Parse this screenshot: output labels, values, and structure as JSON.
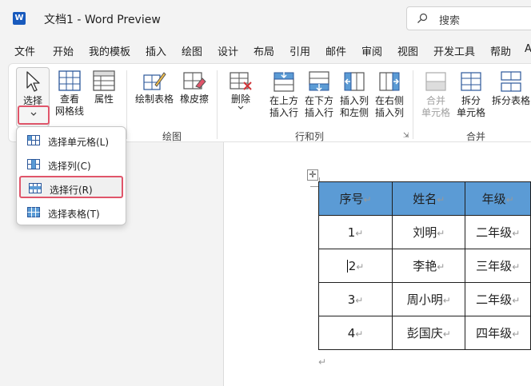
{
  "window": {
    "app_icon_letter": "W",
    "title": "文档1  -  Word Preview",
    "search_placeholder": "搜索"
  },
  "menu": {
    "tabs": [
      "文件",
      "开始",
      "我的模板",
      "插入",
      "绘图",
      "设计",
      "布局",
      "引用",
      "邮件",
      "审阅",
      "视图",
      "开发工具",
      "帮助",
      "A"
    ]
  },
  "ribbon": {
    "select_label": "选择",
    "view_gridlines_line1": "查看",
    "view_gridlines_line2": "网格线",
    "properties_label": "属性",
    "draw_table_label": "绘制表格",
    "eraser_label": "橡皮擦",
    "delete_label": "删除",
    "insert_above_line1": "在上方",
    "insert_above_line2": "插入行",
    "insert_below_line1": "在下方",
    "insert_below_line2": "插入行",
    "insert_left_line1": "插入列",
    "insert_left_line2": "和左侧",
    "insert_right_line1": "在右侧",
    "insert_right_line2": "插入列",
    "merge_cells_line1": "合并",
    "merge_cells_line2": "单元格",
    "split_cells_line1": "拆分",
    "split_cells_line2": "单元格",
    "split_table_label": "拆分表格",
    "group_draw": "绘图",
    "group_rows_cols": "行和列",
    "group_merge": "合并"
  },
  "dropdown": {
    "items": [
      "选择单元格(L)",
      "选择列(C)",
      "选择行(R)",
      "选择表格(T)"
    ],
    "highlighted_index": 2
  },
  "table": {
    "headers": [
      "序号",
      "姓名",
      "年级"
    ],
    "rows": [
      [
        "1",
        "刘明",
        "二年级"
      ],
      [
        "2",
        "李艳",
        "三年级"
      ],
      [
        "3",
        "周小明",
        "二年级"
      ],
      [
        "4",
        "彭国庆",
        "四年级"
      ]
    ],
    "paragraph_mark": "↵",
    "header_color": "#5b9bd5"
  },
  "colors": {
    "highlight_border": "#e0556a",
    "word_blue": "#185abd"
  }
}
